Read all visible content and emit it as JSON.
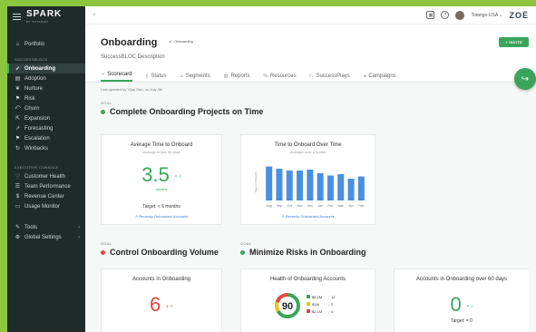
{
  "sidebar": {
    "logo": "SPARK",
    "logo_sub": "BY TOTANGO",
    "portfolio": "Portfolio",
    "section1": "SUCCESSBLOCS",
    "items": [
      {
        "label": "Onboarding",
        "icon": "rocket-icon",
        "active": true
      },
      {
        "label": "Adoption",
        "icon": "chart-icon"
      },
      {
        "label": "Nurture",
        "icon": "leaf-icon"
      },
      {
        "label": "Risk",
        "icon": "flag-icon"
      },
      {
        "label": "Churn",
        "icon": "churn-icon"
      },
      {
        "label": "Expansion",
        "icon": "expansion-icon"
      },
      {
        "label": "Forecasting",
        "icon": "forecast-icon"
      },
      {
        "label": "Escalation",
        "icon": "escalation-icon"
      },
      {
        "label": "Winbacks",
        "icon": "winback-icon"
      }
    ],
    "section2": "EXECUTIVE CONSOLE",
    "exec_items": [
      {
        "label": "Customer Health",
        "icon": "heart-icon"
      },
      {
        "label": "Team Performance",
        "icon": "team-icon"
      },
      {
        "label": "Revenue Center",
        "icon": "dollar-icon"
      },
      {
        "label": "Usage Monitor",
        "icon": "monitor-icon"
      }
    ],
    "tools": "Tools",
    "global_settings": "Global Settings"
  },
  "topbar": {
    "search_placeholder": "",
    "account": "Totango-USA ⌄",
    "brand": "ZOË"
  },
  "page": {
    "title": "Onboarding",
    "badge": "Onboarding",
    "subtitle": "SuccessBLOC Description",
    "invite": "INVITE",
    "tabs": [
      {
        "label": "Scorecard",
        "active": true
      },
      {
        "label": "Status"
      },
      {
        "label": "Segments"
      },
      {
        "label": "Reports"
      },
      {
        "label": "Resources"
      },
      {
        "label": "SuccessPlays"
      },
      {
        "label": "Campaigns"
      }
    ],
    "updated": "Last updated by Vijay Rao, on July 4th"
  },
  "goals": [
    {
      "label": "GOAL",
      "title": "Complete Onboarding Projects on Time",
      "color": "#3aa55a"
    },
    {
      "label": "GOAL",
      "title": "Control Onboarding Volume",
      "color": "#e04a3f"
    },
    {
      "label": "GOAL",
      "title": "Minimize Risks in Onboarding",
      "color": "#3aa55a"
    }
  ],
  "cards": {
    "avg_time": {
      "title": "Average Time to Onboard",
      "sub": "Average in last 90 days",
      "value": "3.5",
      "delta": "▾ -1",
      "unit": "months",
      "target": "Target: < 6 months",
      "link": "Recently Onboarded Accounts"
    },
    "time_over_time": {
      "title": "Time to Onboard Over Time",
      "sub": "Average over a month",
      "link": "Recently Onboarded Accounts",
      "ylabel": "Days to Onboard"
    },
    "accounts_onboarding": {
      "title": "Accounts in Onboarding",
      "value": "6",
      "delta": "▴ +1"
    },
    "health": {
      "title": "Health of Onboarding Accounts",
      "score": "90",
      "legend": [
        {
          "value": "$6.2M",
          "count": "12",
          "color": "#3aa55a"
        },
        {
          "value": "$1M",
          "count": "2",
          "color": "#f0c419"
        },
        {
          "value": "$2.1M",
          "count": "4",
          "color": "#e04a3f"
        }
      ]
    },
    "over_60": {
      "title": "Accounts in Onboarding over 60 days",
      "value": "0",
      "delta": "▾ -1",
      "target": "Target: = 0"
    }
  },
  "chart_data": {
    "type": "bar",
    "title": "Time to Onboard Over Time",
    "ylabel": "Days to Onboard",
    "categories": [
      "Aug",
      "Sep",
      "Oct",
      "Nov",
      "Dec",
      "Jan",
      "Feb",
      "Mar",
      "Apr",
      "Feb"
    ],
    "values": [
      75,
      70,
      66,
      66,
      68,
      60,
      55,
      58,
      48,
      53
    ],
    "ylim": [
      0,
      80
    ]
  }
}
